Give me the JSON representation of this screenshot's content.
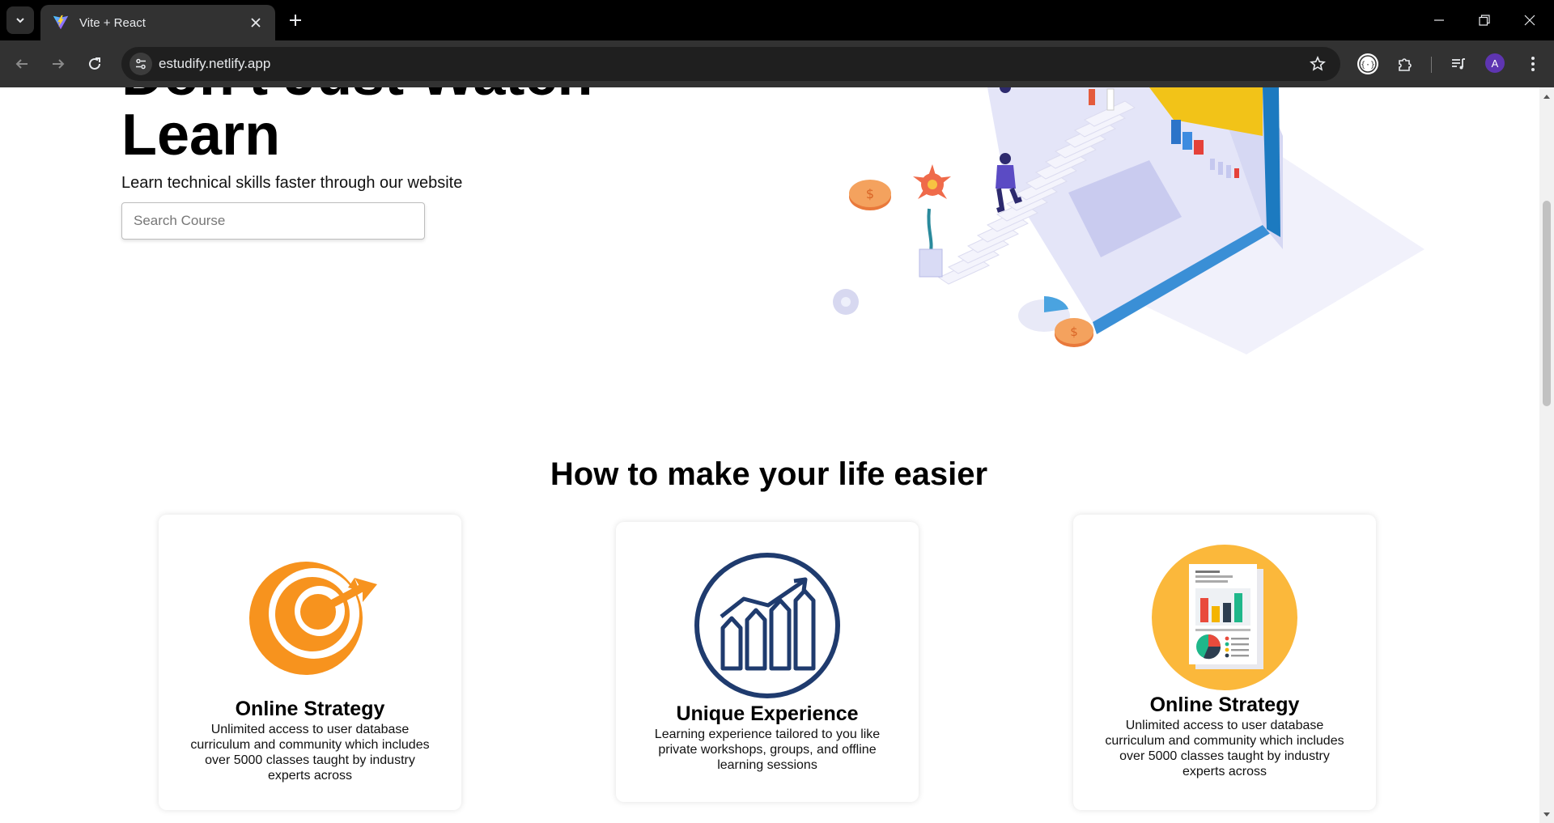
{
  "browser": {
    "tab_title": "Vite + React",
    "url": "estudify.netlify.app",
    "profile_initial": "A"
  },
  "hero": {
    "title_line1": "Don't Just Watch",
    "title_line2": "Learn",
    "subtitle": "Learn technical skills faster through our website",
    "search_placeholder": "Search Course",
    "search_value": ""
  },
  "features": {
    "heading": "How to make your life easier",
    "cards": [
      {
        "title": "Online Strategy",
        "description": "Unlimited access to user database curriculum and community which includes over 5000 classes taught by industry experts across",
        "icon": "target-arrow-icon"
      },
      {
        "title": "Unique Experience",
        "description": "Learning experience tailored to you like private workshops, groups, and offline learning sessions",
        "icon": "growth-chart-icon"
      },
      {
        "title": "Online Strategy",
        "description": "Unlimited access to user database curriculum and community which includes over 5000 classes taught by industry experts across",
        "icon": "report-document-icon"
      }
    ]
  },
  "colors": {
    "accent_orange": "#f7931e",
    "navy": "#1f3b6e",
    "report_yellow": "#fbb83b"
  }
}
